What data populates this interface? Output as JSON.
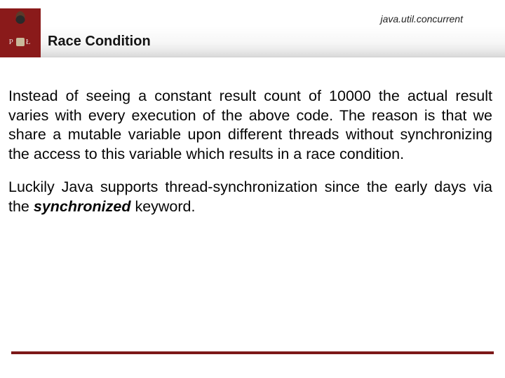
{
  "header": {
    "package_label": "java.util.concurrent",
    "logo_left": "P",
    "logo_right": "Ł"
  },
  "title": "Race Condition",
  "body": {
    "p1_a": "Instead of seeing a constant result count of 10000 the actual result varies with every execution of the above code. The reason is that we share a mutable variable upon different threads without synchronizing the access to this variable which results in a race condition.",
    "p2_a": "Luckily Java supports thread-synchronization since the early days via the ",
    "p2_kw": "synchronized",
    "p2_b": " keyword."
  },
  "colors": {
    "brand": "#8a1a1a"
  }
}
